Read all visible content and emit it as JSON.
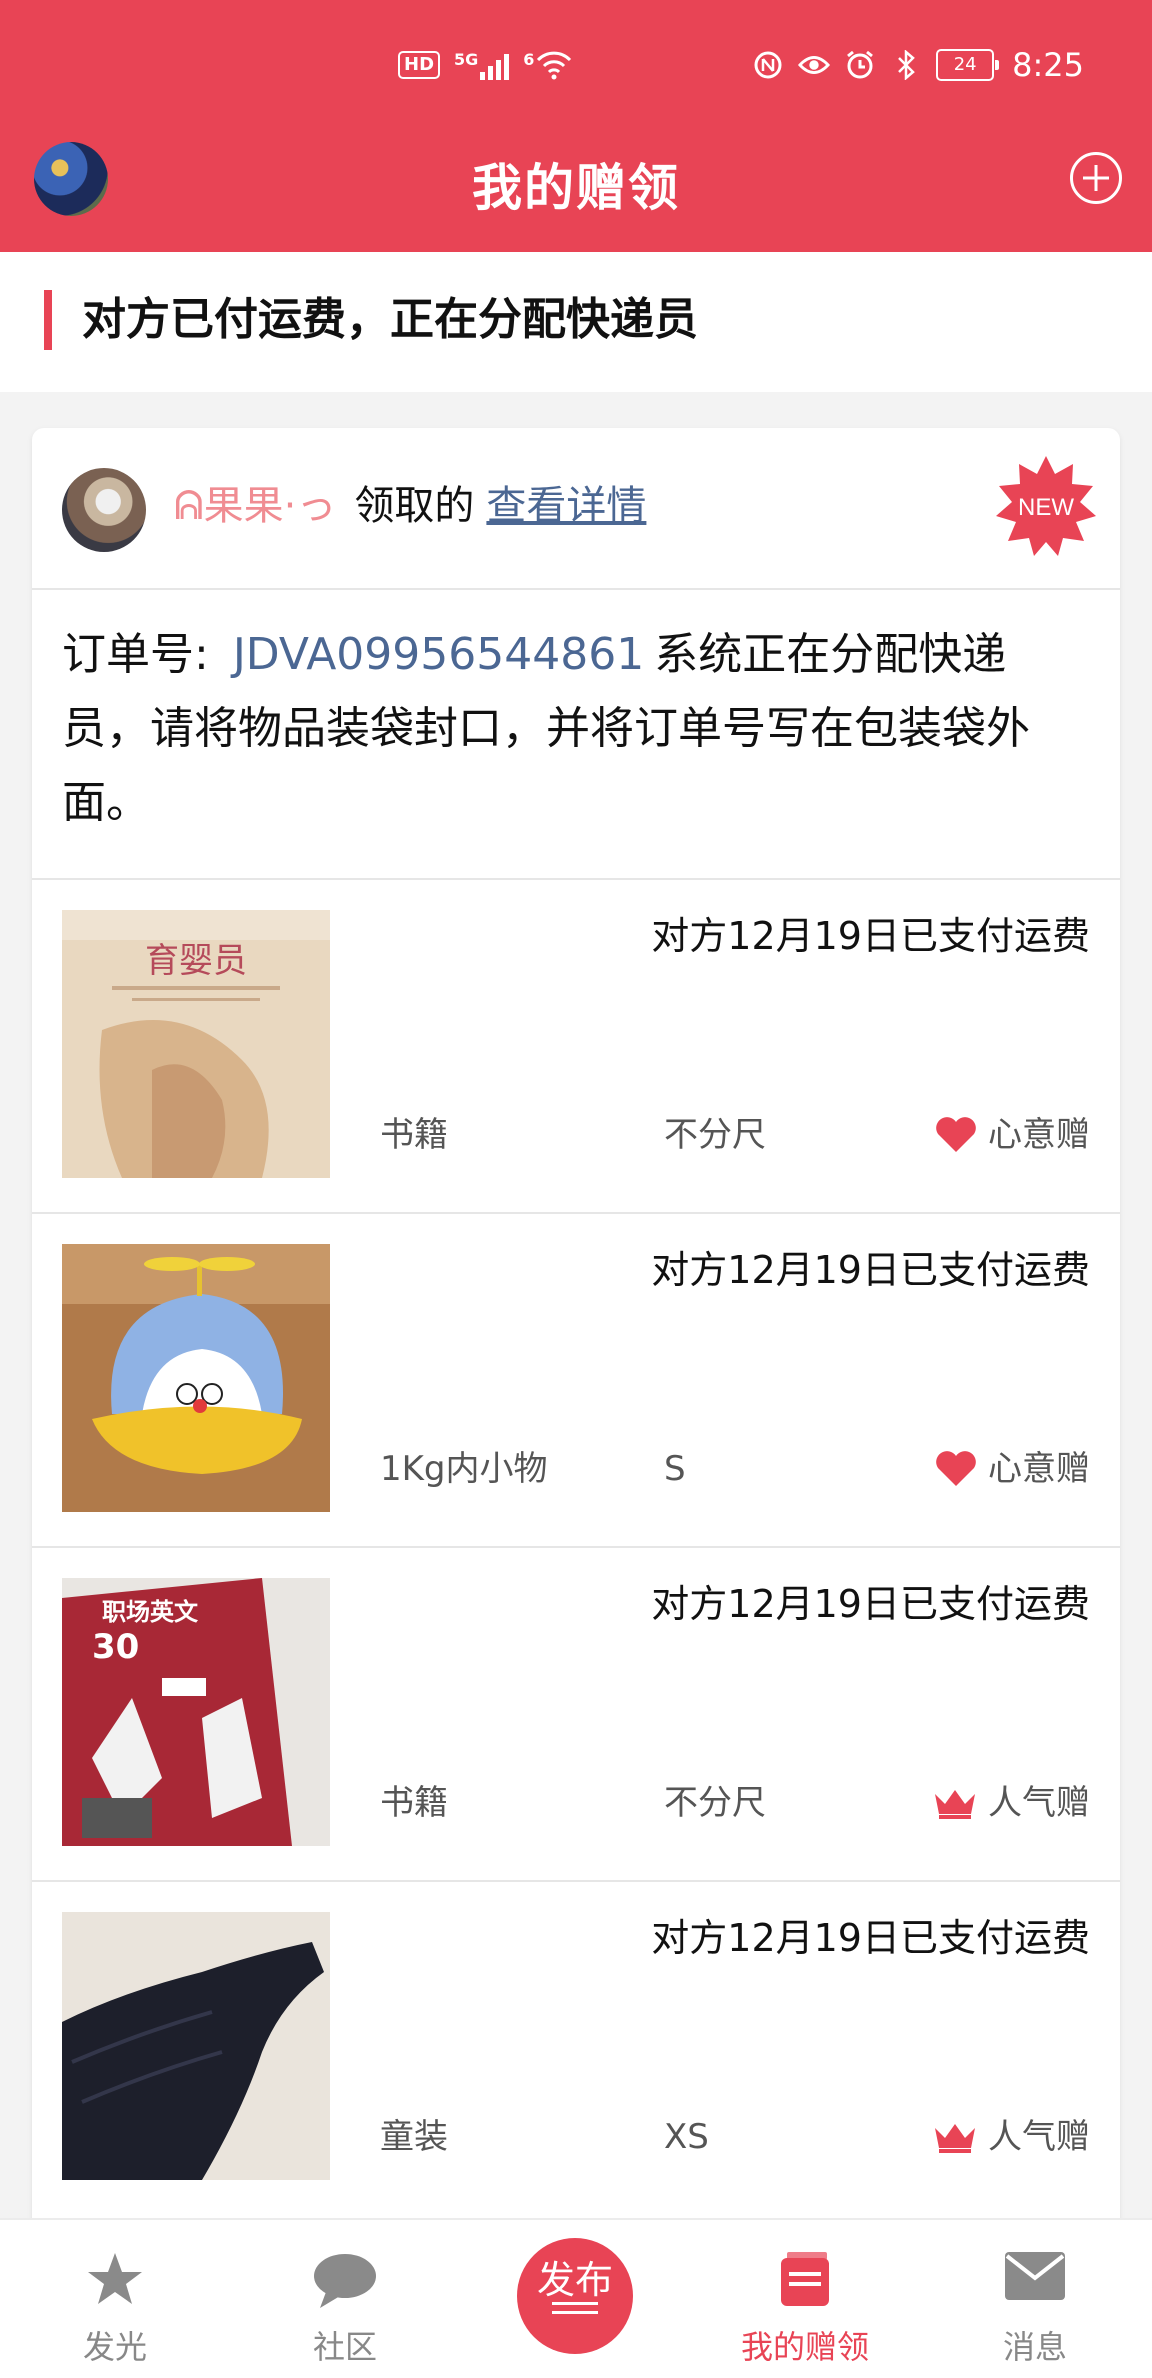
{
  "status_bar": {
    "network": "HD",
    "signal": "5G",
    "wifi": "6",
    "battery": "24",
    "time": "8:25",
    "icons": [
      "nfc-icon",
      "eye-icon",
      "alarm-icon",
      "bluetooth-icon"
    ]
  },
  "header": {
    "title": "我的赠领"
  },
  "section": {
    "title": "对方已付运费，正在分配快递员"
  },
  "card": {
    "claimer_name": "ᕱ果果·っ",
    "claim_text": "领取的",
    "detail_link": "查看详情",
    "badge": "NEW",
    "order_label": "订单号:",
    "order_number": "JDVA09956544861",
    "order_message": "系统正在分配快递员，请将物品装袋封口，并将订单号写在包装袋外面。"
  },
  "items": [
    {
      "status": "对方12月19日已支付运费",
      "category": "书籍",
      "size": "不分尺",
      "type": "心意赠",
      "type_icon": "heart-icon",
      "thumb": "book-yuyingyuan"
    },
    {
      "status": "对方12月19日已支付运费",
      "category": "1Kg内小物",
      "size": "S",
      "type": "心意赠",
      "type_icon": "heart-icon",
      "thumb": "doraemon-cap"
    },
    {
      "status": "对方12月19日已支付运费",
      "category": "书籍",
      "size": "不分尺",
      "type": "人气赠",
      "type_icon": "crown-icon",
      "thumb": "book-english"
    },
    {
      "status": "对方12月19日已支付运费",
      "category": "童装",
      "size": "XS",
      "type": "人气赠",
      "type_icon": "crown-icon",
      "thumb": "kids-clothes"
    }
  ],
  "nav": {
    "items": [
      {
        "label": "发光",
        "icon": "star-icon"
      },
      {
        "label": "社区",
        "icon": "chat-icon"
      },
      {
        "label": "发布",
        "icon": "publish-icon"
      },
      {
        "label": "我的赠领",
        "icon": "book-icon"
      },
      {
        "label": "消息",
        "icon": "mail-icon"
      }
    ],
    "active": "我的赠领"
  },
  "colors": {
    "brand": "#e84455",
    "link": "#4b6793",
    "muted": "#555555"
  }
}
